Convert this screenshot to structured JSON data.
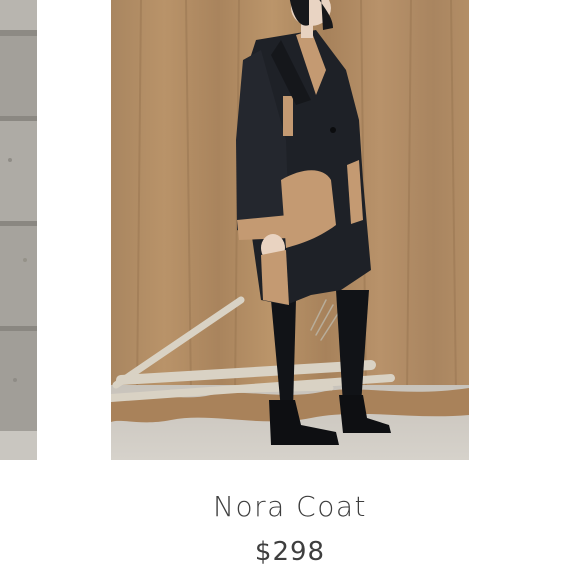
{
  "product": {
    "name": "Nora Coat",
    "price": "$298"
  },
  "colors": {
    "backdrop": "#b08a60",
    "coat": "#1e2127",
    "accent": "#c49a72",
    "text": "#3e3e3e"
  }
}
